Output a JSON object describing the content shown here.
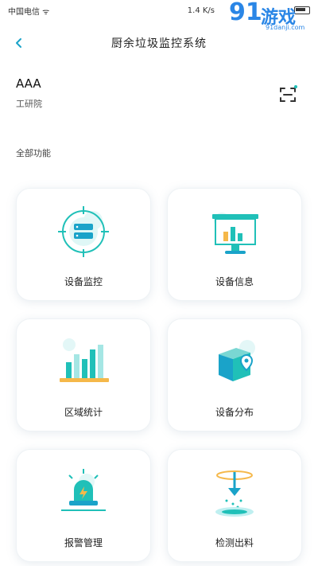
{
  "status": {
    "carrier": "中国电信 ᯤ",
    "speed": "1.4 K/s"
  },
  "watermark": {
    "big": "91",
    "cn": "游戏",
    "url": "91danji.com"
  },
  "nav": {
    "back": "‹",
    "title": "厨余垃圾监控系统"
  },
  "user": {
    "name": "AAA",
    "org": "工研院"
  },
  "section": {
    "title": "全部功能"
  },
  "functions": [
    {
      "label": "设备监控",
      "icon": "device-monitor-icon"
    },
    {
      "label": "设备信息",
      "icon": "device-info-icon"
    },
    {
      "label": "区域统计",
      "icon": "region-stats-icon"
    },
    {
      "label": "设备分布",
      "icon": "device-distribution-icon"
    },
    {
      "label": "报警管理",
      "icon": "alarm-management-icon"
    },
    {
      "label": "检测出料",
      "icon": "detection-output-icon"
    }
  ],
  "colors": {
    "accent": "#1aa3c9",
    "teal": "#20c0b8",
    "light": "#bfeff0"
  }
}
